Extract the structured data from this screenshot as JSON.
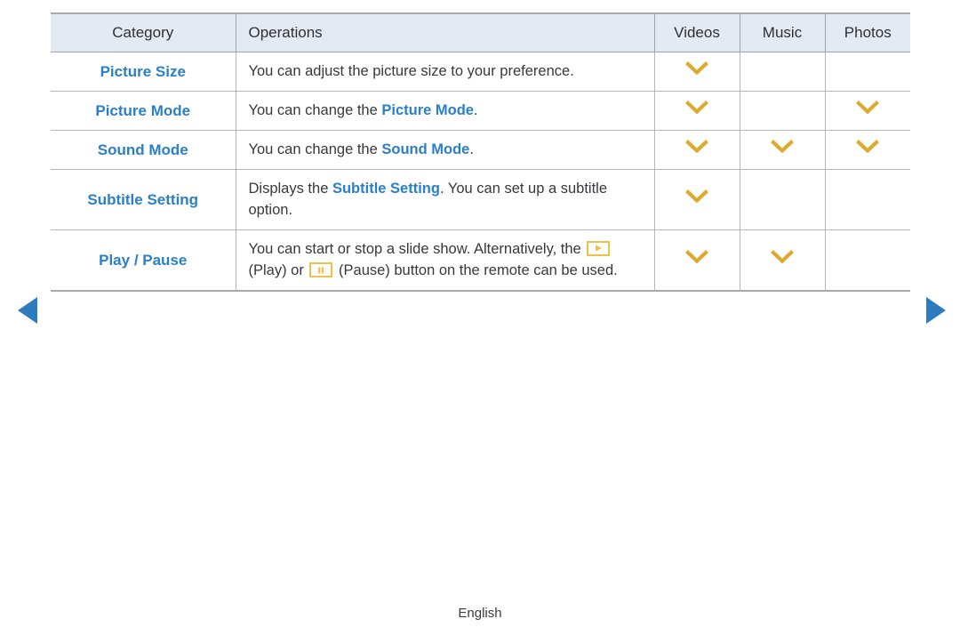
{
  "table": {
    "columns": [
      {
        "key": "category",
        "label": "Category",
        "align": "center"
      },
      {
        "key": "operations",
        "label": "Operations",
        "align": "left"
      },
      {
        "key": "videos",
        "label": "Videos",
        "align": "center"
      },
      {
        "key": "music",
        "label": "Music",
        "align": "center"
      },
      {
        "key": "photos",
        "label": "Photos",
        "align": "center"
      }
    ],
    "rows": [
      {
        "category": "Picture Size",
        "operations_text": "You can adjust the picture size to your preference.",
        "operations_parts": [
          {
            "type": "text",
            "value": "You can adjust the picture size to your preference."
          }
        ],
        "videos": true,
        "music": false,
        "photos": false
      },
      {
        "category": "Picture Mode",
        "operations_text": "You can change the Picture Mode.",
        "operations_parts": [
          {
            "type": "text",
            "value": "You can change the "
          },
          {
            "type": "highlight",
            "value": "Picture Mode"
          },
          {
            "type": "text",
            "value": "."
          }
        ],
        "videos": true,
        "music": false,
        "photos": true
      },
      {
        "category": "Sound Mode",
        "operations_text": "You can change the Sound Mode.",
        "operations_parts": [
          {
            "type": "text",
            "value": "You can change the "
          },
          {
            "type": "highlight",
            "value": "Sound Mode"
          },
          {
            "type": "text",
            "value": "."
          }
        ],
        "videos": true,
        "music": true,
        "photos": true
      },
      {
        "category": "Subtitle Setting",
        "operations_text": "Displays the Subtitle Setting. You can set up a subtitle option.",
        "operations_parts": [
          {
            "type": "text",
            "value": "Displays the "
          },
          {
            "type": "highlight",
            "value": "Subtitle Setting"
          },
          {
            "type": "text",
            "value": ". You can set up a subtitle option."
          }
        ],
        "videos": true,
        "music": false,
        "photos": false
      },
      {
        "category": "Play / Pause",
        "operations_text": "You can start or stop a slide show. Alternatively, the ▶ (Play) or ⏸ (Pause) button on the remote can be used.",
        "operations_parts": [
          {
            "type": "text",
            "value": "You can start or stop a slide show. Alternatively, the "
          },
          {
            "type": "keycap",
            "value": "play-key-icon"
          },
          {
            "type": "text",
            "value": " (Play) or "
          },
          {
            "type": "keycap",
            "value": "pause-key-icon"
          },
          {
            "type": "text",
            "value": " (Pause) button on the remote can be used."
          }
        ],
        "videos": true,
        "music": true,
        "photos": false
      }
    ]
  },
  "navigation": {
    "prev_label": "Previous page",
    "prev_icon": "triangle-left-icon",
    "next_label": "Next page",
    "next_icon": "triangle-right-icon"
  },
  "footer": {
    "language": "English"
  },
  "icons": {
    "supported_mark": "chevron-down-icon",
    "play_key": "play-key-icon",
    "pause_key": "pause-key-icon"
  },
  "colors": {
    "accent_blue": "#2a7fc9",
    "nav_arrow_blue": "#2e7cbe",
    "chevron_gold": "#dfa92e",
    "keycap_gold": "#edc14a",
    "header_bg": "#e3eaf4",
    "header_border": "#9aa4bd",
    "row_border": "#b6b6ba",
    "table_edge": "#a9a9ae",
    "body_text": "#39393d"
  }
}
